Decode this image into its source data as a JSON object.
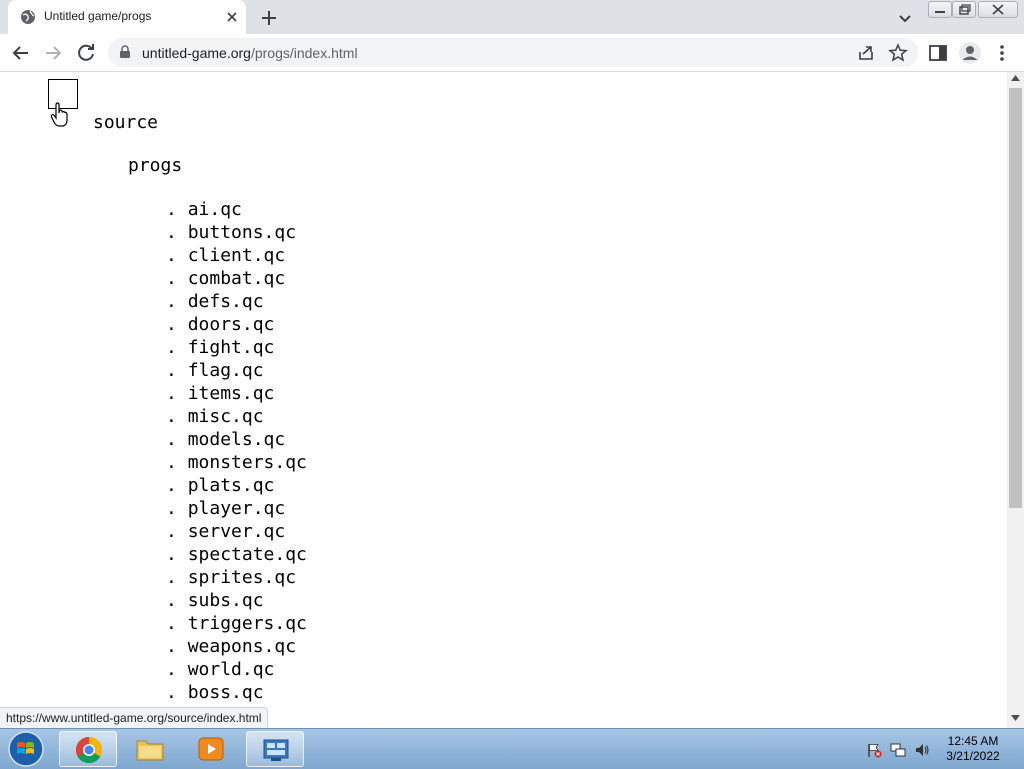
{
  "tab": {
    "title": "Untitled game/progs"
  },
  "address_bar": {
    "host": "untitled-game.org",
    "path": "/progs/index.html"
  },
  "page": {
    "folder_root": "source",
    "folder_sub": "progs",
    "files": [
      "ai.qc",
      "buttons.qc",
      "client.qc",
      "combat.qc",
      "defs.qc",
      "doors.qc",
      "fight.qc",
      "flag.qc",
      "items.qc",
      "misc.qc",
      "models.qc",
      "monsters.qc",
      "plats.qc",
      "player.qc",
      "server.qc",
      "spectate.qc",
      "sprites.qc",
      "subs.qc",
      "triggers.qc",
      "weapons.qc",
      "world.qc",
      "boss.qc"
    ],
    "bullet": ". "
  },
  "status_bar": {
    "url": "https://www.untitled-game.org/source/index.html"
  },
  "taskbar": {
    "time": "12:45 AM",
    "date": "3/21/2022"
  },
  "icons": {
    "tab_favicon": "globe-icon",
    "tab_close": "close-icon",
    "new_tab": "plus-icon",
    "tab_search": "chevron-down-icon",
    "back": "arrow-left-icon",
    "forward": "arrow-right-icon",
    "reload": "reload-icon",
    "lock": "lock-icon",
    "share": "share-icon",
    "bookmark": "star-icon",
    "side_panel": "side-panel-icon",
    "profile": "profile-icon",
    "menu": "kebab-menu-icon"
  },
  "colors": {
    "tabstrip_bg": "#dee1e6",
    "omnibox_bg": "#f1f3f4",
    "taskbar_bg": "#8fb4da"
  }
}
